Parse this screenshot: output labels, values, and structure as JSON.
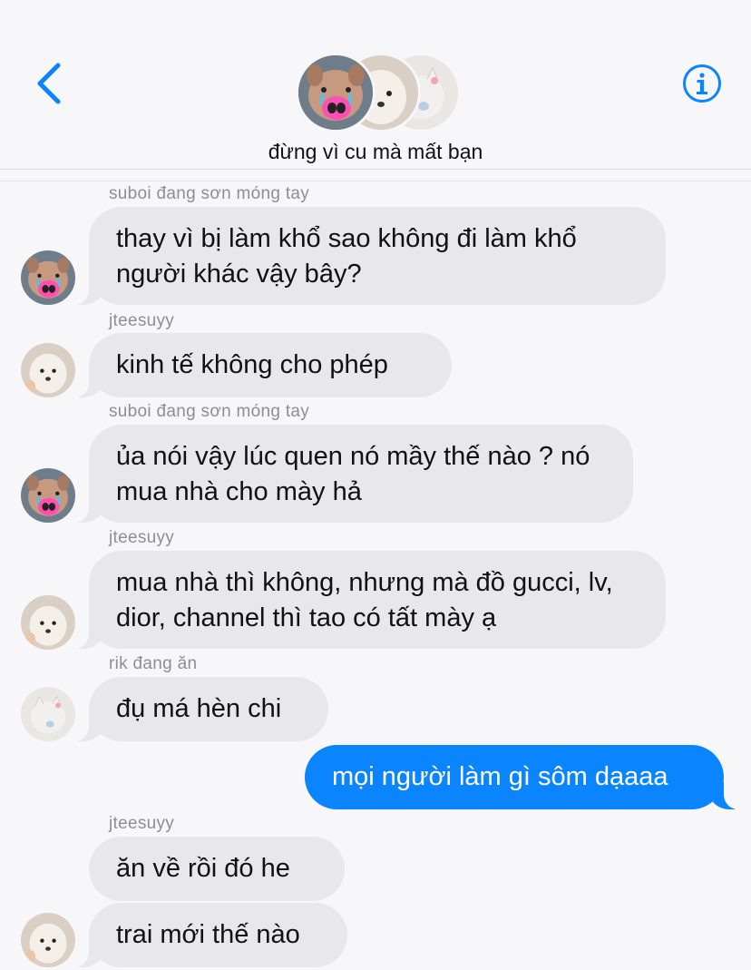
{
  "header": {
    "title": "đừng vì cu mà mất bạn",
    "back_icon": "chevron-left-icon",
    "info_icon": "info-circle-icon",
    "accent": "#0b84ff"
  },
  "messages": [
    {
      "sender": "suboi đang sơn móng tay",
      "text": "thay vì bị làm khổ sao không đi làm khổ người khác vậy bây?"
    },
    {
      "sender": "jteesuyy",
      "text": "kinh tế không cho phép"
    },
    {
      "sender": "suboi đang sơn móng tay",
      "text": "ủa nói vậy lúc quen nó mầy thế nào ? nó mua nhà cho mày hả"
    },
    {
      "sender": "jteesuyy",
      "text": "mua nhà thì không, nhưng mà đồ gucci, lv, dior, channel thì tao có tất mày ạ"
    },
    {
      "sender": "rik đang ăn",
      "text": "đụ má hèn chi"
    },
    {
      "sender": "",
      "text": "mọi người làm gì sôm dạaaa",
      "outgoing": true
    },
    {
      "sender": "jteesuyy",
      "text": "ăn về rồi đó he"
    },
    {
      "sender": "",
      "text": "trai mới thế nào"
    }
  ],
  "colors": {
    "incoming_bubble": "#e8e7ec",
    "outgoing_bubble": "#0b84ff",
    "sender_label": "#8e8e93"
  }
}
